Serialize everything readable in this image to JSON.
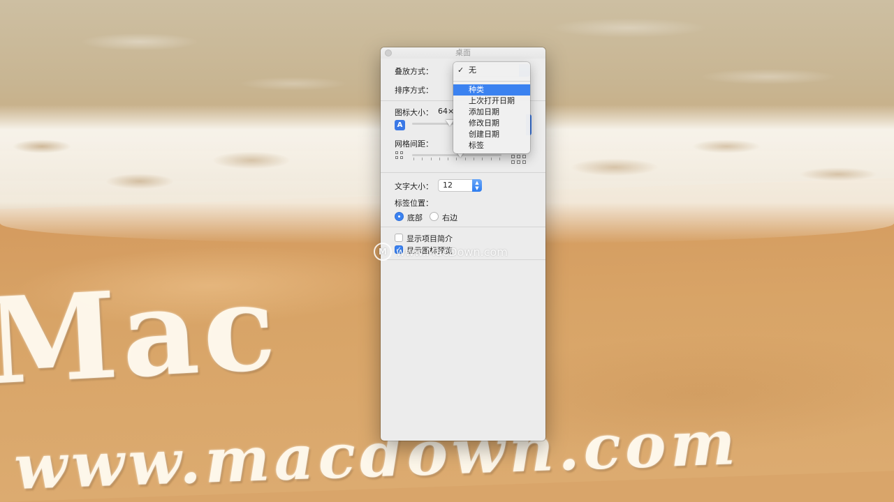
{
  "window": {
    "title": "桌面"
  },
  "view_options": {
    "stack_by_label": "叠放方式：",
    "sort_by_label": "排序方式：",
    "icon_size_label": "图标大小：",
    "icon_size_value": "64×",
    "icon_size_slider_icon_glyph": "A",
    "grid_spacing_label": "网格间距：",
    "text_size_label": "文字大小：",
    "text_size_value": "12",
    "label_position_label": "标签位置：",
    "label_position_options": [
      {
        "label": "底部",
        "selected": true
      },
      {
        "label": "右边",
        "selected": false
      }
    ],
    "checkboxes": [
      {
        "label": "显示项目简介",
        "checked": false
      },
      {
        "label": "显示图标预览",
        "checked": true
      }
    ]
  },
  "stack_menu": {
    "items": [
      {
        "label": "无",
        "checked": true,
        "highlighted": false
      },
      {
        "label": "种类",
        "checked": false,
        "highlighted": true
      },
      {
        "label": "上次打开日期",
        "checked": false,
        "highlighted": false
      },
      {
        "label": "添加日期",
        "checked": false,
        "highlighted": false
      },
      {
        "label": "修改日期",
        "checked": false,
        "highlighted": false
      },
      {
        "label": "创建日期",
        "checked": false,
        "highlighted": false
      },
      {
        "label": "标签",
        "checked": false,
        "highlighted": false
      }
    ],
    "check_glyph": "✓"
  },
  "watermark": {
    "text": "www.MacDown.com",
    "logo_glyph": "M"
  },
  "wallpaper": {
    "sand_text_big": "Mac",
    "sand_text_small": "www.macdown.com"
  },
  "colors": {
    "accent": "#3b82f0",
    "window_bg": "#ececec"
  }
}
